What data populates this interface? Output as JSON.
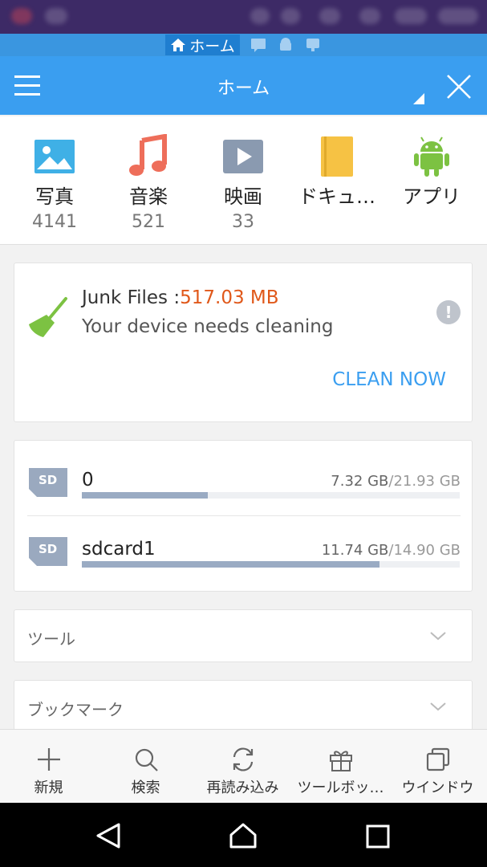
{
  "breadcrumb": {
    "current": "ホーム"
  },
  "app_bar": {
    "title": "ホーム"
  },
  "categories": [
    {
      "label": "写真",
      "count": "4141",
      "icon": "image-icon"
    },
    {
      "label": "音楽",
      "count": "521",
      "icon": "music-note-icon"
    },
    {
      "label": "映画",
      "count": "33",
      "icon": "video-play-icon"
    },
    {
      "label": "ドキュ…",
      "count": "",
      "icon": "document-icon"
    },
    {
      "label": "アプリ",
      "count": "",
      "icon": "android-icon"
    }
  ],
  "junk": {
    "title_prefix": "Junk Files :",
    "size": "517.03 MB",
    "subtitle": "Your device needs cleaning",
    "action": "CLEAN NOW"
  },
  "storage": [
    {
      "name": "0",
      "used": "7.32 GB",
      "total": "/21.93 GB",
      "fraction": 0.334
    },
    {
      "name": "sdcard1",
      "used": "11.74 GB",
      "total": "/14.90 GB",
      "fraction": 0.788
    }
  ],
  "sections": {
    "tools": "ツール",
    "bookmarks": "ブックマーク"
  },
  "toolbar": [
    {
      "label": "新規",
      "icon": "plus-icon"
    },
    {
      "label": "検索",
      "icon": "search-icon"
    },
    {
      "label": "再読み込み",
      "icon": "refresh-icon"
    },
    {
      "label": "ツールボッ…",
      "icon": "gift-icon"
    },
    {
      "label": "ウインドウ",
      "icon": "windows-icon"
    }
  ],
  "colors": {
    "primary": "#3a9ef0",
    "accent_orange": "#e0581a",
    "status_bar": "#3d2a66"
  }
}
